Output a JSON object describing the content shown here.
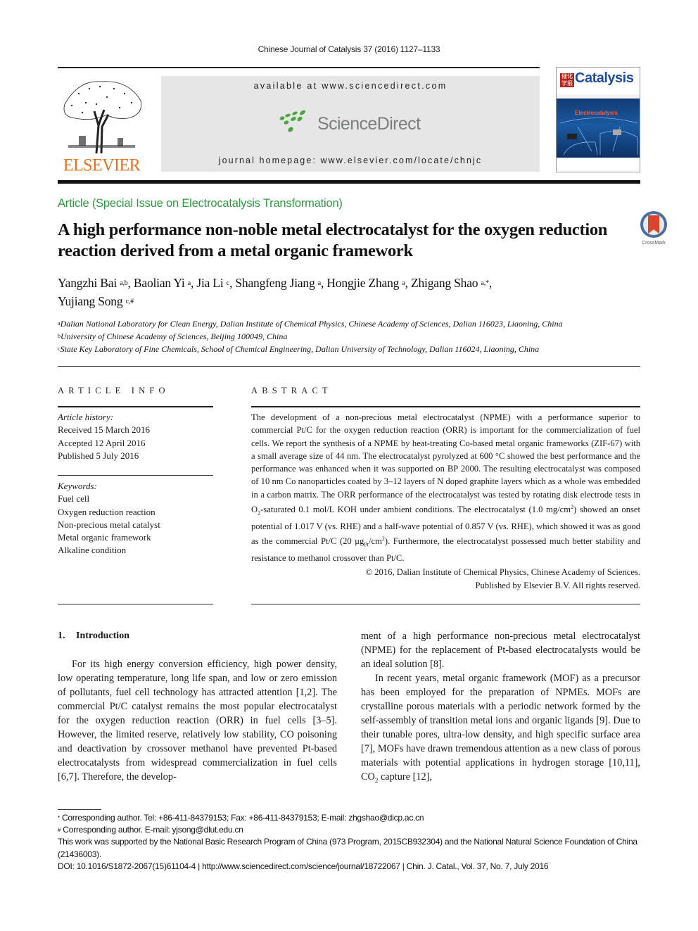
{
  "header": {
    "journal_ref": "Chinese Journal of Catalysis 37 (2016) 1127–1133",
    "publisher_logo_text": "ELSEVIER",
    "available_at": "available at www.sciencedirect.com",
    "sciencedirect_logo_text": "ScienceDirect",
    "journal_homepage": "journal homepage: www.elsevier.com/locate/chnjc",
    "cover": {
      "title": "Catalysis",
      "seal_text": "催化学报",
      "feature_text": "Electrocatalysis"
    },
    "colors": {
      "elsevier_orange": "#e8721c",
      "sciencedirect_green": "#4aa63c",
      "sciencedirect_gray": "#7b7f7c",
      "article_type_green": "#2e9a3f"
    }
  },
  "article": {
    "type": "Article (Special Issue on Electrocatalysis Transformation)",
    "title": "A high performance non-noble metal electrocatalyst for the oxygen reduction reaction derived from a metal organic framework",
    "crossmark_label": "CrossMark",
    "authors": [
      {
        "name": "Yangzhi Bai",
        "sup": "a,b",
        "sep": ", "
      },
      {
        "name": "Baolian Yi",
        "sup": "a",
        "sep": ", "
      },
      {
        "name": "Jia Li",
        "sup": "c",
        "sep": ", "
      },
      {
        "name": "Shangfeng Jiang",
        "sup": "a",
        "sep": ", "
      },
      {
        "name": "Hongjie Zhang",
        "sup": "a",
        "sep": ", "
      },
      {
        "name": "Zhigang Shao",
        "sup": "a,*",
        "sep": ","
      },
      {
        "name": "Yujiang Song",
        "sup": "c,#",
        "sep": ""
      }
    ],
    "affiliations": [
      {
        "key": "a",
        "text": "Dalian National Laboratory for Clean Energy, Dalian Institute of Chemical Physics, Chinese Academy of Sciences, Dalian 116023, Liaoning, China"
      },
      {
        "key": "b",
        "text": "University of Chinese Academy of Sciences, Beijing 100049, China"
      },
      {
        "key": "c",
        "text": "State Key Laboratory of Fine Chemicals, School of Chemical Engineering, Dalian University of Technology, Dalian 116024, Liaoning, China"
      }
    ]
  },
  "article_info": {
    "label": "ARTICLE INFO",
    "history_label": "Article history:",
    "history": [
      "Received 15 March 2016",
      "Accepted 12 April 2016",
      "Published 5 July 2016"
    ],
    "keywords_label": "Keywords:",
    "keywords": [
      "Fuel cell",
      "Oxygen reduction reaction",
      "Non-precious metal catalyst",
      "Metal organic framework",
      "Alkaline condition"
    ]
  },
  "abstract": {
    "label": "ABSTRACT",
    "p1": "The development of a non-precious metal electrocatalyst (NPME) with a performance superior to commercial Pt/C for the oxygen reduction reaction (ORR) is important for the commercialization of fuel cells. We report the synthesis of a NPME by heat-treating Co-based metal organic frameworks (ZIF-67) with a small average size of 44 nm. The electrocatalyst pyrolyzed at 600 °C showed the best performance and the performance was enhanced when it was supported on BP 2000. The resulting electrocatalyst was composed of 10 nm Co nanoparticles coated by 3–12 layers of N doped graphite layers which as a whole was embedded in a carbon matrix. The ORR performance of the electrocatalyst was tested by rotating disk electrode tests in O",
    "o2_sub": "2",
    "p2": "-saturated 0.1 mol/L KOH under ambient conditions. The electrocatalyst (1.0 mg/cm",
    "sq1": "2",
    "p3": ") showed an onset potential of 1.017 V (vs. RHE) and a half-wave potential of 0.857 V (vs. RHE), which showed it was as good as the commercial Pt/C (20 μg",
    "pt_sub": "Pt",
    "p4": "/cm",
    "sq2": "2",
    "p5": "). Furthermore, the electrocatalyst possessed much better stability and resistance to methanol crossover than Pt/C.",
    "copyright_line1": "© 2016, Dalian Institute of Chemical Physics, Chinese Academy of Sciences.",
    "copyright_line2": "Published by Elsevier B.V. All rights reserved."
  },
  "introduction": {
    "number": "1.",
    "heading": "Introduction",
    "left_p1": "For its high energy conversion efficiency, high power density, low operating temperature, long life span, and low or zero emission of pollutants, fuel cell technology has attracted attention [1,2]. The commercial Pt/C catalyst remains the most popular electrocatalyst for the oxygen reduction reaction (ORR) in fuel cells [3–5]. However, the limited reserve, relatively low stability, CO poisoning and deactivation by crossover methanol have prevented Pt-based electrocatalysts from widespread commercialization in fuel cells [6,7]. Therefore, the develop-",
    "right_p1": "ment of a high performance non-precious metal electrocatalyst (NPME) for the replacement of Pt-based electrocatalysts would be an ideal solution [8].",
    "right_p2": "In recent years, metal organic framework (MOF) as a precursor has been employed for the preparation of NPMEs. MOFs are crystalline porous materials with a periodic network formed by the self-assembly of transition metal ions and organic ligands [9]. Due to their tunable pores, ultra-low density, and high specific surface area [7], MOFs have drawn tremendous attention as a new class of porous materials with potential applications in hydrogen storage [10,11], CO",
    "co2_sub": "2",
    "right_p2_end": " capture [12],"
  },
  "footnotes": {
    "corr1_mark": "*",
    "corr1": " Corresponding author. Tel: +86-411-84379153; Fax: +86-411-84379153; E-mail: zhgshao@dicp.ac.cn",
    "corr2_mark": "#",
    "corr2": " Corresponding author. E-mail: yjsong@dlut.edu.cn",
    "funding": "This work was supported by the National Basic Research Program of China (973 Program, 2015CB932304) and the National Natural Science Foundation of China (21436003).",
    "doi_line": "DOI: 10.1016/S1872-2067(15)61104-4 | http://www.sciencedirect.com/science/journal/18722067 | Chin. J. Catal., Vol. 37, No. 7, July 2016"
  }
}
